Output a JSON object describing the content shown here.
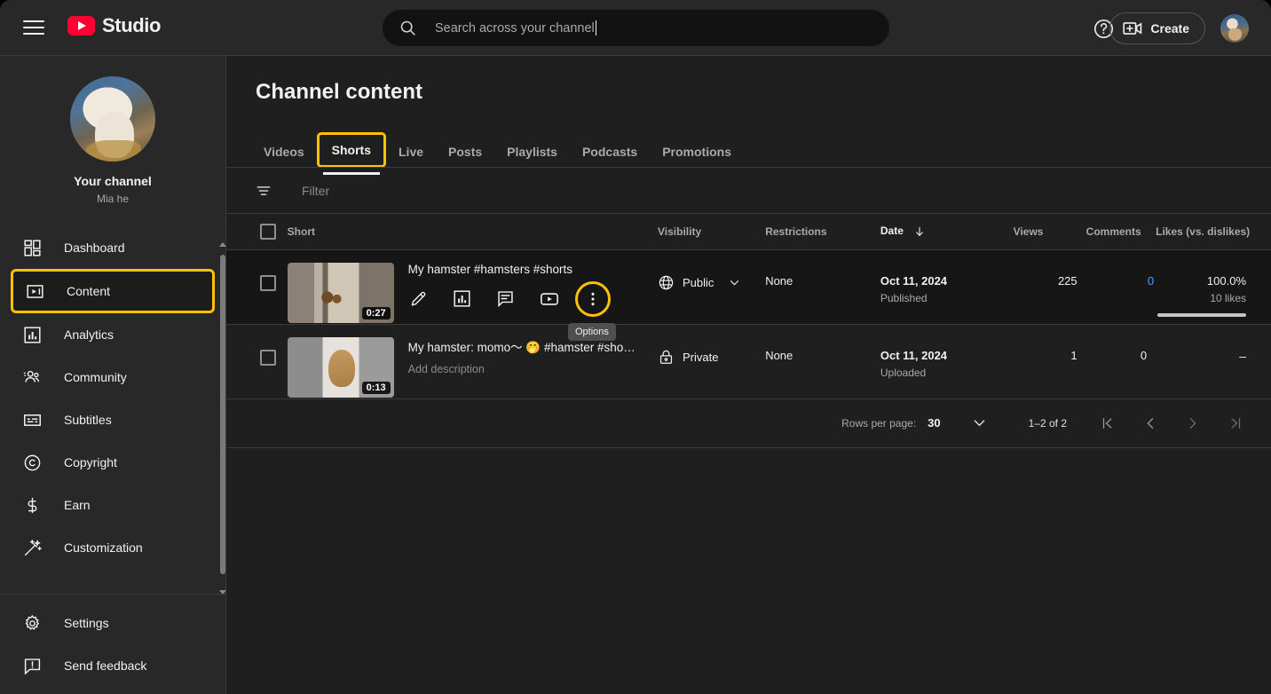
{
  "header": {
    "menu_icon": "hamburger-menu-icon",
    "brand": "Studio",
    "search": {
      "placeholder": "Search across your channel",
      "value": "",
      "icon": "search-icon"
    },
    "help_icon": "help-circle-icon",
    "create_label": "Create",
    "create_icon": "video-plus-icon",
    "avatar_name": "account-avatar"
  },
  "sidebar": {
    "channel_label": "Your channel",
    "channel_name": "Mia he",
    "items": [
      {
        "label": "Dashboard",
        "icon": "dashboard-grid-icon",
        "active": false
      },
      {
        "label": "Content",
        "icon": "content-play-icon",
        "active": true
      },
      {
        "label": "Analytics",
        "icon": "analytics-bar-icon",
        "active": false
      },
      {
        "label": "Community",
        "icon": "community-people-icon",
        "active": false
      },
      {
        "label": "Subtitles",
        "icon": "subtitles-icon",
        "active": false
      },
      {
        "label": "Copyright",
        "icon": "copyright-icon",
        "active": false
      },
      {
        "label": "Earn",
        "icon": "dollar-icon",
        "active": false
      },
      {
        "label": "Customization",
        "icon": "magic-wand-icon",
        "active": false
      }
    ],
    "bottom_items": [
      {
        "label": "Settings",
        "icon": "gear-icon"
      },
      {
        "label": "Send feedback",
        "icon": "feedback-icon"
      }
    ]
  },
  "main": {
    "page_title": "Channel content",
    "tabs": [
      {
        "label": "Videos",
        "active": false
      },
      {
        "label": "Shorts",
        "active": true
      },
      {
        "label": "Live",
        "active": false
      },
      {
        "label": "Posts",
        "active": false
      },
      {
        "label": "Playlists",
        "active": false
      },
      {
        "label": "Podcasts",
        "active": false
      },
      {
        "label": "Promotions",
        "active": false
      }
    ],
    "filter": {
      "icon": "filter-icon",
      "placeholder": "Filter",
      "value": ""
    },
    "columns": {
      "short": "Short",
      "visibility": "Visibility",
      "restrictions": "Restrictions",
      "date": "Date",
      "date_sort": "descending",
      "views": "Views",
      "comments": "Comments",
      "likes": "Likes (vs. dislikes)"
    },
    "rows": [
      {
        "title": "My hamster #hamsters #shorts",
        "description": "",
        "duration": "0:27",
        "visibility": "Public",
        "visibility_icon": "globe-icon",
        "restrictions": "None",
        "date": "Oct 11, 2024",
        "date_status": "Published",
        "views": "225",
        "comments": "0",
        "likes_pct": "100.0%",
        "likes_count": "10 likes",
        "hovered": true,
        "actions": [
          {
            "name": "edit-pencil-icon",
            "label": "Details"
          },
          {
            "name": "analytics-bar-icon",
            "label": "Analytics"
          },
          {
            "name": "comments-icon",
            "label": "Comments"
          },
          {
            "name": "youtube-play-icon",
            "label": "View on YouTube"
          },
          {
            "name": "options-kebab-icon",
            "label": "Options"
          }
        ]
      },
      {
        "title": "My hamster: momo〜 🤭 #hamster #sho…",
        "description": "Add description",
        "duration": "0:13",
        "visibility": "Private",
        "visibility_icon": "lock-icon",
        "restrictions": "None",
        "date": "Oct 11, 2024",
        "date_status": "Uploaded",
        "views": "1",
        "comments": "0",
        "likes_pct": "–",
        "likes_count": "",
        "hovered": false,
        "actions": []
      }
    ],
    "tooltip": "Options",
    "footer": {
      "rows_per_page_label": "Rows per page:",
      "rows_per_page_value": "30",
      "range": "1–2 of 2",
      "first_page": "|<",
      "prev_page": "<",
      "next_page": ">",
      "last_page": ">|"
    }
  },
  "colors": {
    "accent_highlight": "#ffc107",
    "brand_red": "#ff0033",
    "link_blue": "#3ea6ff",
    "bg": "#1f1f1f",
    "panel": "#282828"
  }
}
